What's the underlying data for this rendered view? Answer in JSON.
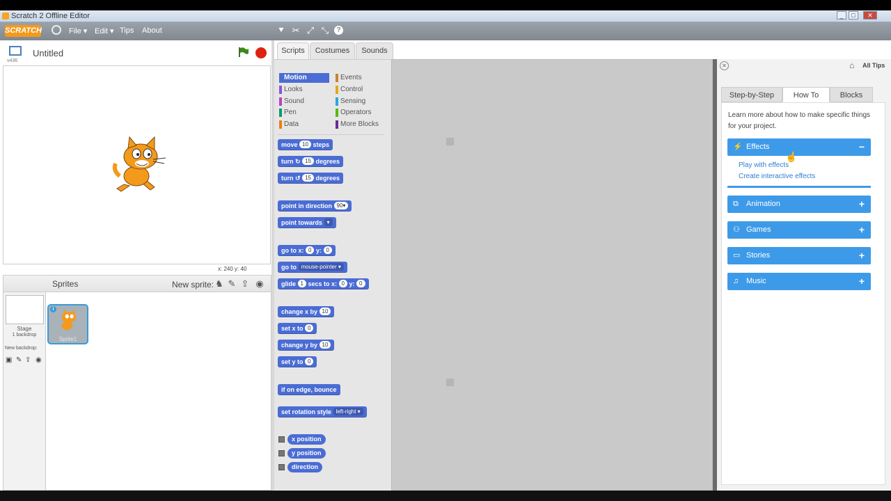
{
  "window": {
    "title": "Scratch 2 Offline Editor",
    "min": "_",
    "max": "□",
    "close": "✕"
  },
  "menubar": {
    "logo": "SCRATCH",
    "file": "File ▾",
    "edit": "Edit ▾",
    "tips": "Tips",
    "about": "About"
  },
  "stage": {
    "title": "Untitled",
    "version": "v436",
    "coords": "x: 240   y: 40"
  },
  "sprites": {
    "label": "Sprites",
    "new_sprite": "New sprite:",
    "stage_label": "Stage",
    "stage_sub": "1 backdrop",
    "new_backdrop": "New backdrop:",
    "sprite_name": "Sprite1"
  },
  "tabs": {
    "scripts": "Scripts",
    "costumes": "Costumes",
    "sounds": "Sounds"
  },
  "categories": {
    "motion": "Motion",
    "looks": "Looks",
    "sound": "Sound",
    "pen": "Pen",
    "data": "Data",
    "events": "Events",
    "control": "Control",
    "sensing": "Sensing",
    "operators": "Operators",
    "more": "More Blocks"
  },
  "blocks": {
    "move_a": "move",
    "move_v": "10",
    "move_b": "steps",
    "turn_a": "turn",
    "turn_cw": "↻",
    "turn_v": "15",
    "turn_b": "degrees",
    "turn_ccw": "↺",
    "turn2_v": "15",
    "point_dir": "point in direction",
    "point_dir_v": "90▾",
    "point_towards": "point towards",
    "point_towards_v": "▾",
    "goto_a": "go to x:",
    "goto_x": "0",
    "goto_b": "y:",
    "goto_y": "0",
    "goto2": "go to",
    "goto2_v": "mouse-pointer ▾",
    "glide_a": "glide",
    "glide_v": "1",
    "glide_b": "secs to x:",
    "glide_x": "0",
    "glide_c": "y:",
    "glide_y": "0",
    "chx_a": "change x by",
    "chx_v": "10",
    "setx_a": "set x to",
    "setx_v": "0",
    "chy_a": "change y by",
    "chy_v": "10",
    "sety_a": "set y to",
    "sety_v": "0",
    "bounce": "if on edge, bounce",
    "rot_a": "set rotation style",
    "rot_v": "left-right ▾",
    "xpos": "x position",
    "ypos": "y position",
    "dir": "direction"
  },
  "tips": {
    "all_tips": "All Tips",
    "tab_step": "Step-by-Step",
    "tab_howto": "How To",
    "tab_blocks": "Blocks",
    "intro": "Learn more about how to make specific things for your project.",
    "effects": "Effects",
    "effects_toggle": "−",
    "play_effects": "Play with effects",
    "interactive_effects": "Create interactive effects",
    "animation": "Animation",
    "games": "Games",
    "stories": "Stories",
    "music": "Music",
    "plus": "+"
  },
  "colors": {
    "motion": "#4a6cd4",
    "looks": "#8a55d7",
    "sound": "#bb42c3",
    "pen": "#0e9a6c",
    "data": "#ee7d16",
    "events": "#c88330",
    "control": "#e1a91a",
    "sensing": "#2ca5e2",
    "operators": "#5cb712",
    "more": "#632d99",
    "accordion": "#3d9ae8"
  }
}
